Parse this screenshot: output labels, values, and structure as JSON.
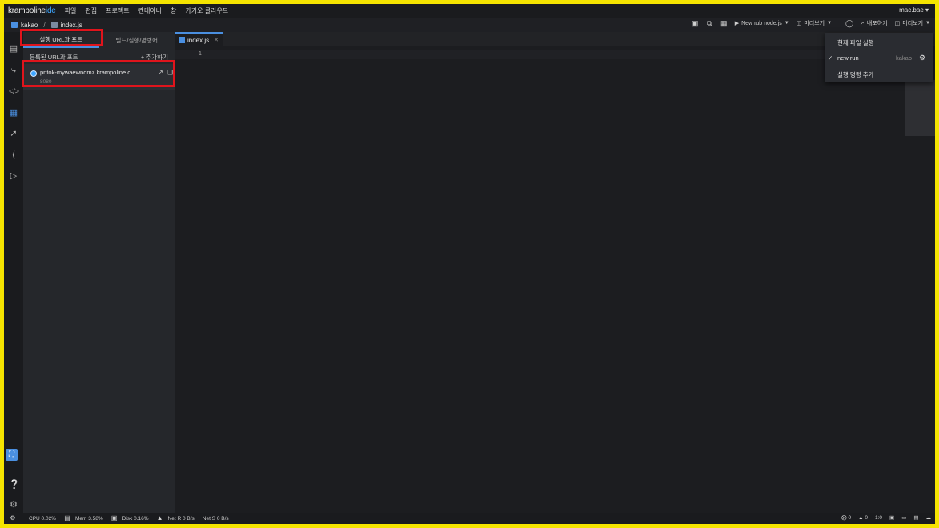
{
  "app": {
    "logo_main": "krampoline",
    "logo_ide": "ide",
    "menu": [
      "파일",
      "편집",
      "프로젝트",
      "컨테이너",
      "창",
      "카카오 클라우드"
    ],
    "user": "mac.bae ▾"
  },
  "breadcrumb": {
    "project": "kakao",
    "separator": "/",
    "file": "index.js"
  },
  "toolbar": {
    "run_label": "New rub node.js",
    "preview_label": "미리보기",
    "deploy_label": "배포하기",
    "preview2_label": "미리보기"
  },
  "panel": {
    "tabs": [
      "실행 URL과 포트",
      "빌드/실행/명령어"
    ],
    "header": "등록된 URL과 포트",
    "add_label": "+ 추가하기",
    "url_item": {
      "url": "pntok-mywaewnqmz.krampoline.c...",
      "port": "8080"
    }
  },
  "editor": {
    "tab_label": "index.js",
    "line_number": "1"
  },
  "dropdown": {
    "items": [
      {
        "label": "현재 파일 실행",
        "checked": false
      },
      {
        "label": "new run",
        "checked": true,
        "meta": "kakao"
      },
      {
        "label": "실행 명령 추가",
        "checked": false
      }
    ]
  },
  "status": {
    "cpu": "CPU 0.02%",
    "mem": "Mem 3.58%",
    "disk": "Disk 0.16%",
    "net_r": "Net R 0 B/s",
    "net_s": "Net S 0 B/s",
    "errors": "0",
    "warnings": "0",
    "position": "1:0"
  },
  "colors": {
    "accent": "#4a8fe0",
    "highlight": "#e0141c",
    "frame": "#f5e400"
  }
}
